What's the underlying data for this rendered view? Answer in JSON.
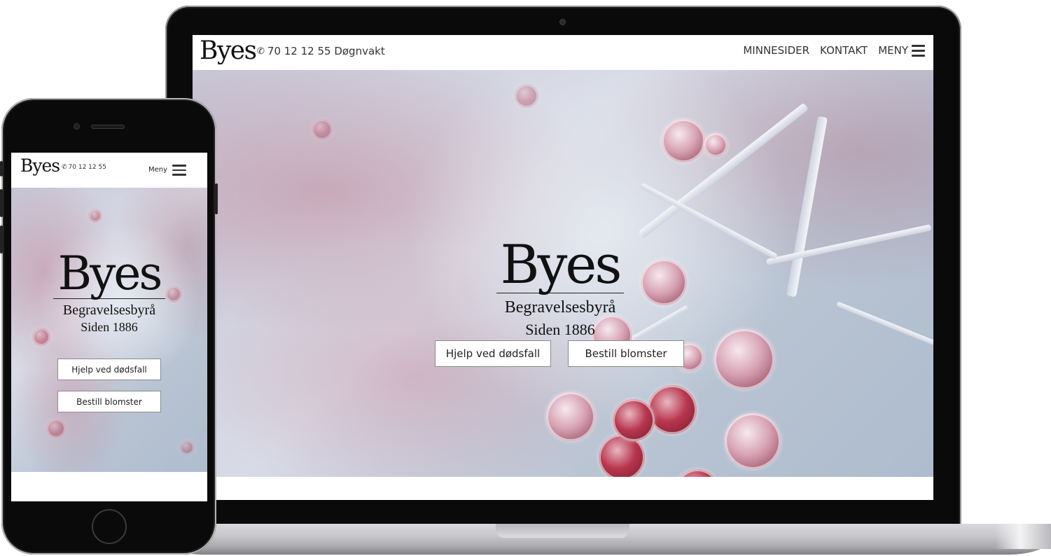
{
  "brand": {
    "logo_text": "Byes",
    "tagline_line1": "Begravelsesbyrå",
    "tagline_line2": "Siden 1886"
  },
  "desktop": {
    "phone_number": "70 12 12 55 Døgnvakt",
    "nav": {
      "memorial_pages": "MINNESIDER",
      "contact": "KONTAKT",
      "menu": "MENY"
    },
    "buttons": {
      "help": "Hjelp ved dødsfall",
      "flowers": "Bestill blomster"
    }
  },
  "mobile": {
    "phone_number": "70 12 12 55",
    "menu": "Meny",
    "buttons": {
      "help": "Hjelp ved dødsfall",
      "flowers": "Bestill blomster"
    }
  },
  "icons": {
    "phone": "phone-icon",
    "menu": "hamburger-menu-icon"
  },
  "colors": {
    "header_bg": "#ffffff",
    "text": "#333333",
    "button_bg": "#ffffff",
    "device_frame": "#0a0a0a"
  }
}
